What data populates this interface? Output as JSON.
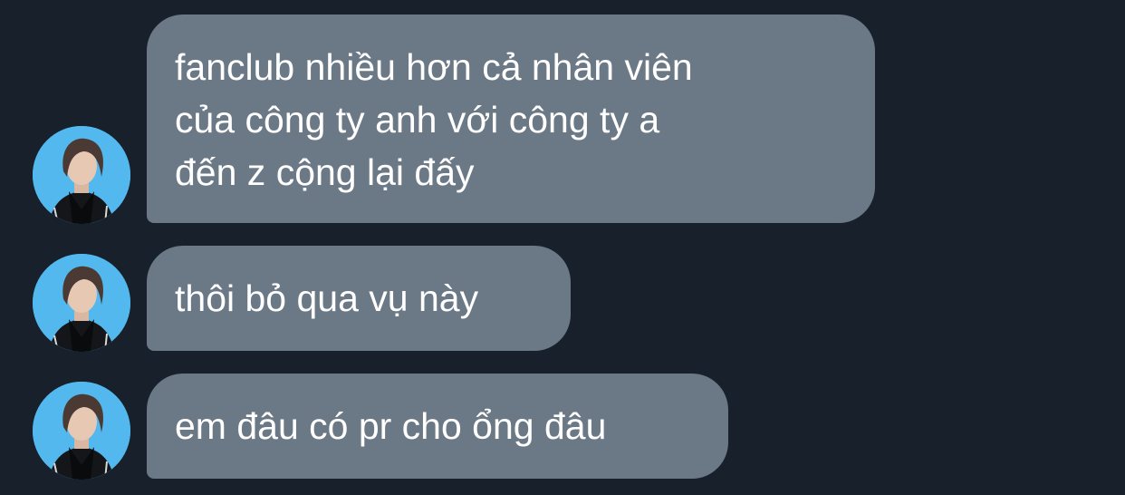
{
  "conversation": {
    "messages": [
      {
        "sender_avatar": "avatar-photo",
        "lines": [
          "fanclub nhiều hơn cả nhân viên",
          "của công ty anh với công ty a",
          "đến z cộng lại đấy"
        ]
      },
      {
        "sender_avatar": "avatar-photo",
        "lines": [
          "thôi bỏ qua vụ này"
        ]
      },
      {
        "sender_avatar": "avatar-photo",
        "lines": [
          "em đâu có pr cho ổng đâu"
        ]
      }
    ]
  },
  "colors": {
    "background": "#17202b",
    "bubble": "#6b7886",
    "text": "#ffffff",
    "avatar_background": "#52b8ee"
  }
}
